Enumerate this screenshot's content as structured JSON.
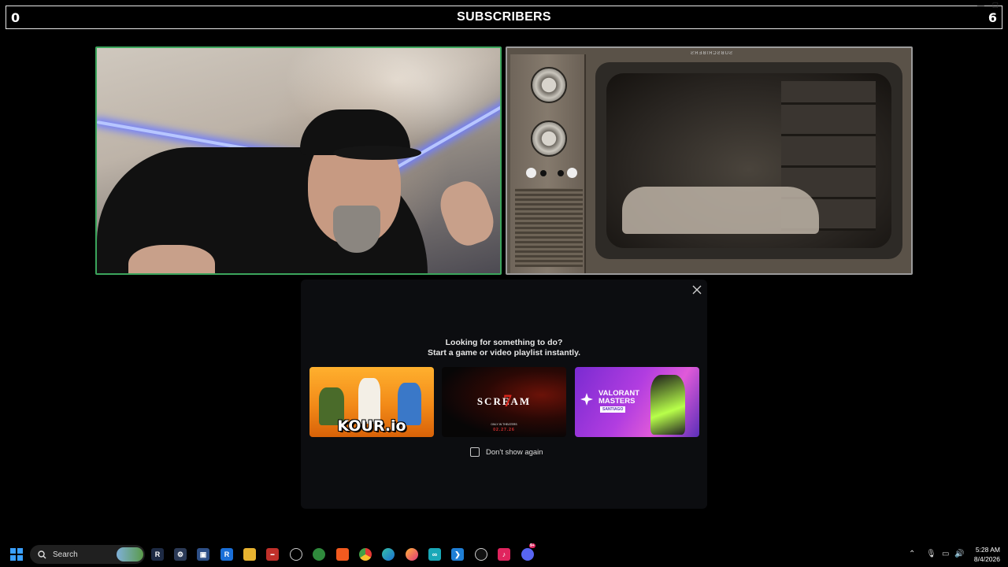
{
  "subscriber_bar": {
    "left_count": "0",
    "title": "SUBSCRIBERS",
    "right_count": "6"
  },
  "camera_tiles": {
    "left": {
      "border_color": "#3ba55c"
    },
    "right": {
      "tv_label": "SUBSCRIBERS"
    }
  },
  "modal": {
    "heading": "Looking for something to do?",
    "subheading": "Start a game or video playlist instantly.",
    "cards": [
      {
        "title": "KOUR.io",
        "icon": "game-thumbnail"
      },
      {
        "title": "SCREAM",
        "number": "7",
        "tagline": "ONLY IN THEATERS",
        "date": "02.27.26",
        "icon": "movie-thumbnail"
      },
      {
        "title": "VALORANT\nMASTERS",
        "subtitle": "SANTIAGO",
        "icon": "esports-thumbnail"
      }
    ],
    "checkbox_label": "Don't show again",
    "checkbox_checked": false
  },
  "taskbar": {
    "search_placeholder": "Search",
    "clock_time": "5:28 AM",
    "clock_date": "8/4/2026",
    "discord_badge": "9+"
  },
  "colors": {
    "accent_green": "#3ba55c",
    "windows_blue": "#3aa0ff",
    "modal_bg": "#0c0d10"
  }
}
